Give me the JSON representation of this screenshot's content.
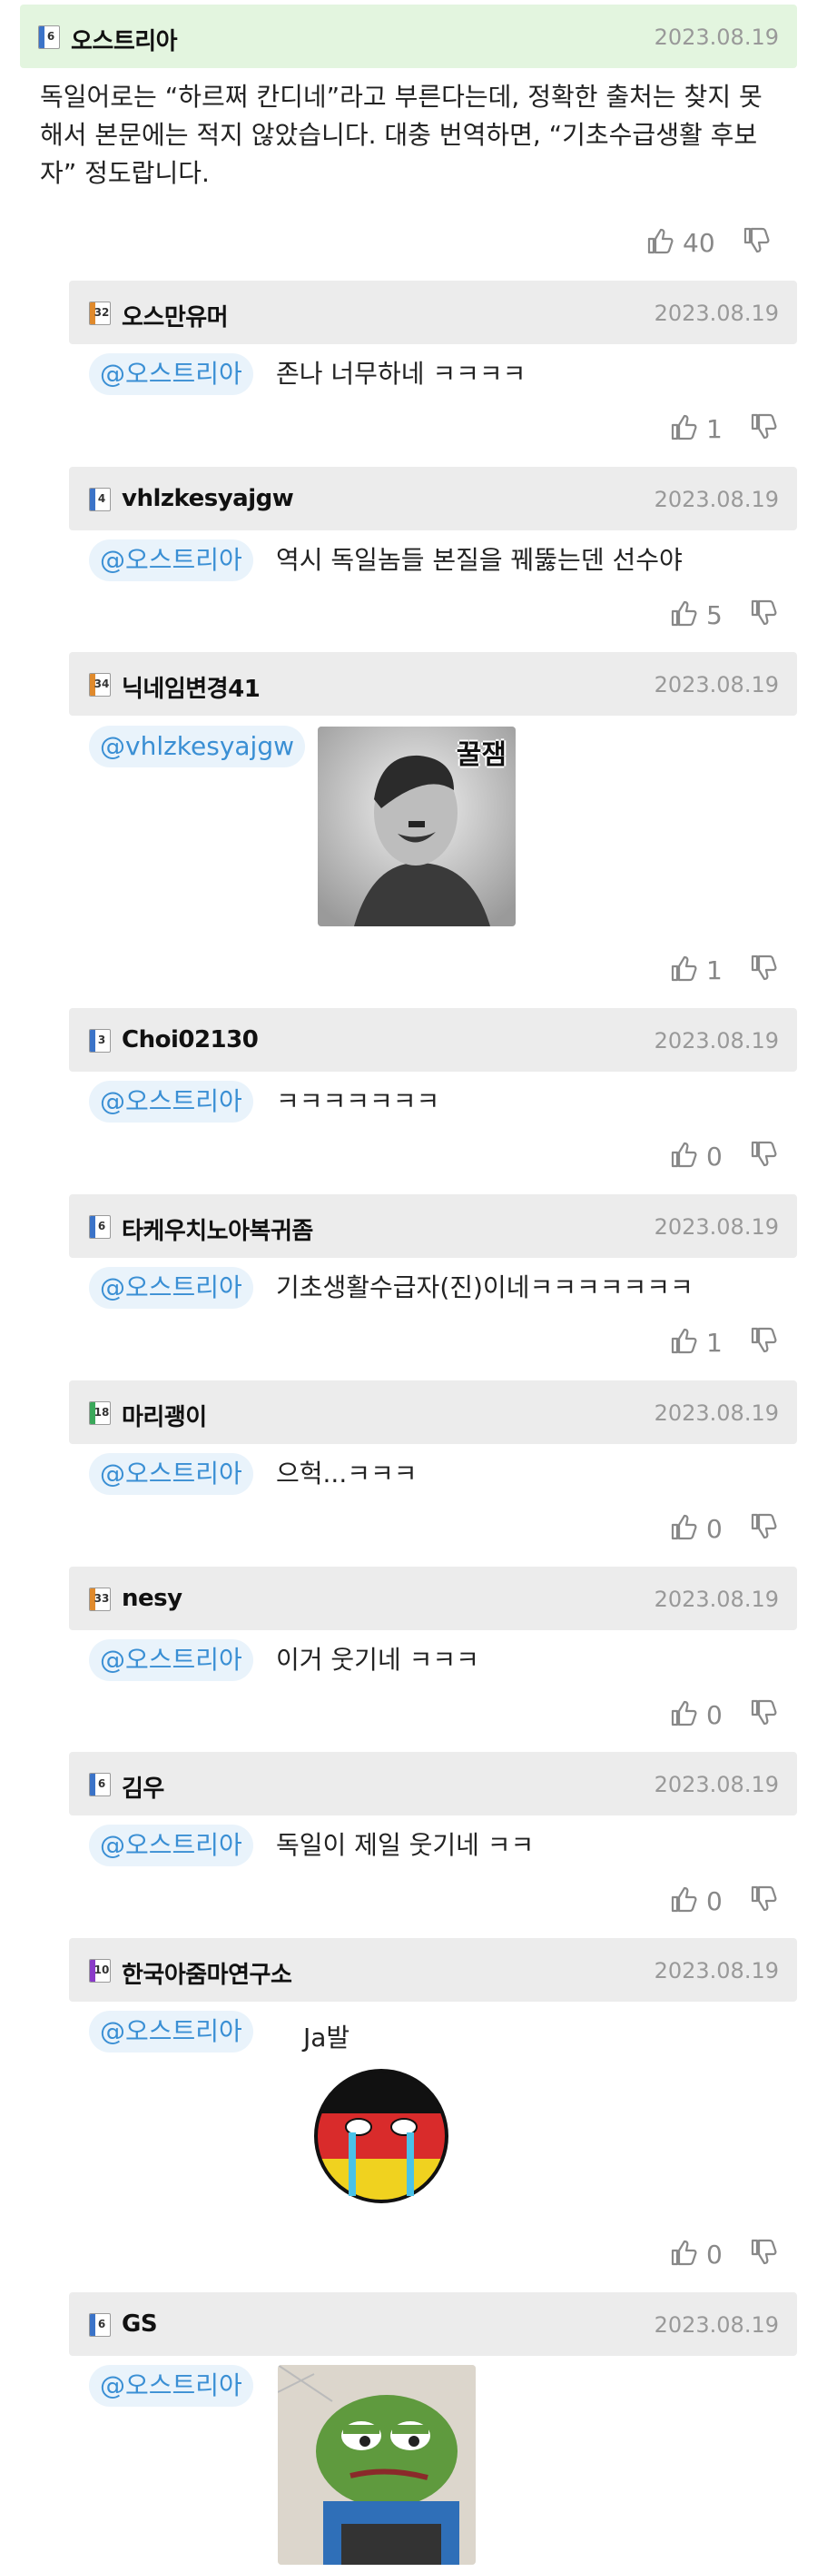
{
  "top_comment": {
    "level": "6",
    "author": "오스트리아",
    "date": "2023.08.19",
    "body_lines": [
      "독일어로는 “하르쩌 칸디네”라고 부른다는데, 정확한 출처는 찾지 못",
      "해서 본문에는 적지 않았습니다. 대충 번역하면, “기초수급생활 후보",
      "자” 정도랍니다."
    ],
    "likes": "40"
  },
  "replies": [
    {
      "level": "32",
      "author": "오스만유머",
      "date": "2023.08.19",
      "mention": "@오스트리아",
      "text": "존나 너무하네 ㅋㅋㅋㅋ",
      "likes": "1"
    },
    {
      "level": "4",
      "author": "vhlzkesyajgw",
      "date": "2023.08.19",
      "mention": "@오스트리아",
      "text": "역시 독일놈들 본질을 꿰뚫는덴 선수야",
      "likes": "5"
    },
    {
      "level": "34",
      "author": "닉네임변경41",
      "date": "2023.08.19",
      "mention": "@vhlzkesyajgw",
      "image_caption": "꿀잼",
      "likes": "1"
    },
    {
      "level": "3",
      "author": "Choi02130",
      "date": "2023.08.19",
      "mention": "@오스트리아",
      "text": "ㅋㅋㅋㅋㅋㅋㅋ",
      "likes": "0"
    },
    {
      "level": "6",
      "author": "타케우치노아복귀좀",
      "date": "2023.08.19",
      "mention": "@오스트리아",
      "text": "기초생활수급자(진)이네ㅋㅋㅋㅋㅋㅋㅋ",
      "likes": "1"
    },
    {
      "level": "18",
      "author": "마리괭이",
      "date": "2023.08.19",
      "mention": "@오스트리아",
      "text": "으헉...ㅋㅋㅋ",
      "likes": "0"
    },
    {
      "level": "33",
      "author": "nesy",
      "date": "2023.08.19",
      "mention": "@오스트리아",
      "text": "이거 웃기네 ㅋㅋㅋ",
      "likes": "0"
    },
    {
      "level": "6",
      "author": "김우",
      "date": "2023.08.19",
      "mention": "@오스트리아",
      "text": "독일이 제일 웃기네 ㅋㅋ",
      "likes": "0"
    },
    {
      "level": "10",
      "author": "한국아줌마연구소",
      "date": "2023.08.19",
      "mention": "@오스트리아",
      "image_caption": "Ja발",
      "likes": "0"
    },
    {
      "level": "6",
      "author": "GS",
      "date": "2023.08.19",
      "mention": "@오스트리아"
    }
  ],
  "icons": {
    "like": "thumbs-up-icon",
    "dislike": "thumbs-down-icon"
  },
  "colors": {
    "top_header_bg": "#e3f5df",
    "reply_header_bg": "#ececec",
    "mention_text": "#3a8fd4",
    "mention_bg": "#e9f3fb"
  }
}
